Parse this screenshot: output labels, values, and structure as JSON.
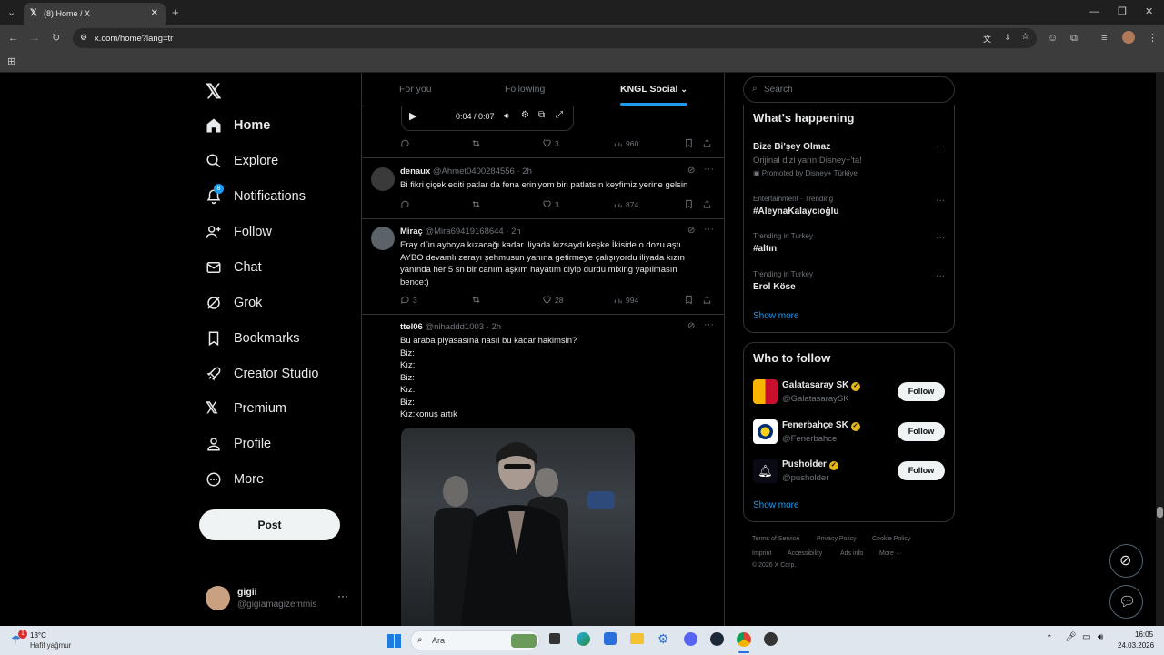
{
  "browser": {
    "tab_title": "(8) Home / X",
    "url": "x.com/home?lang=tr"
  },
  "nav": {
    "items": [
      "Home",
      "Explore",
      "Notifications",
      "Follow",
      "Chat",
      "Grok",
      "Bookmarks",
      "Creator Studio",
      "Premium",
      "Profile",
      "More"
    ],
    "notif_badge": "8",
    "post_label": "Post",
    "account_name": "gigii",
    "account_handle": "@gigiamagizemmis"
  },
  "center": {
    "tabs": [
      "For you",
      "Following",
      "KNGL Social"
    ],
    "video_time": "0:04 / 0:07",
    "top_actions": {
      "likes": "3",
      "views": "960"
    },
    "tweets": [
      {
        "name": "denaux",
        "handle": "@Ahmet0400284556",
        "time": "· 2h",
        "text": "Bi fikri çiçek editi patlar da fena eriniyom biri patlatsın keyfimiz yerine gelsin",
        "replies": "",
        "likes": "3",
        "views": "874"
      },
      {
        "name": "Miraç",
        "handle": "@Mira69419168644",
        "time": "· 2h",
        "text": "Eray dün ayboya kızacağı kadar iliyada kızsaydı keşke İkiside o dozu aştı AYBO devamlı zerayı şehmusun yanına getirmeye çalışıyordu iliyada kızın yanında her 5 sn bir canım aşkım hayatım diyip durdu mixing yapılmasın bence:)",
        "replies": "3",
        "likes": "28",
        "views": "994"
      },
      {
        "name": "ttel06",
        "handle": "@nihaddd1003",
        "time": "· 2h",
        "lines": [
          "Bu araba piyasasına nasıl bu kadar hakimsin?",
          "Biz:",
          "Kız:",
          "Biz:",
          "Kız:",
          "Biz:",
          "Kız:konuş artık"
        ]
      }
    ]
  },
  "right": {
    "search_placeholder": "Search",
    "happening_title": "What's happening",
    "trends": [
      {
        "title": "Bize Bi'şey Olmaz",
        "desc": "Orijinal dizi yarın Disney+'ta!",
        "promo": "Promoted by Disney+ Türkiye"
      },
      {
        "meta": "Entertainment · Trending",
        "title": "#AleynaKalaycıoğlu"
      },
      {
        "meta": "Trending in Turkey",
        "title": "#altın"
      },
      {
        "meta": "Trending in Turkey",
        "title": "Erol Köse"
      }
    ],
    "show_more": "Show more",
    "who_title": "Who to follow",
    "follow_label": "Follow",
    "who": [
      {
        "name": "Galatasaray SK",
        "handle": "@GalatasaraySK"
      },
      {
        "name": "Fenerbahçe SK",
        "handle": "@Fenerbahce"
      },
      {
        "name": "Pusholder",
        "handle": "@pusholder"
      }
    ],
    "footer": [
      "Terms of Service",
      "Privacy Policy",
      "Cookie Policy",
      "Imprint",
      "Accessibility",
      "Ads info",
      "More ···",
      "© 2026 X Corp."
    ]
  },
  "taskbar": {
    "temp": "13°C",
    "weather": "Hafif yağmur",
    "weather_badge": "1",
    "search": "Ara",
    "time": "16:05",
    "date": "24.03.2026"
  }
}
